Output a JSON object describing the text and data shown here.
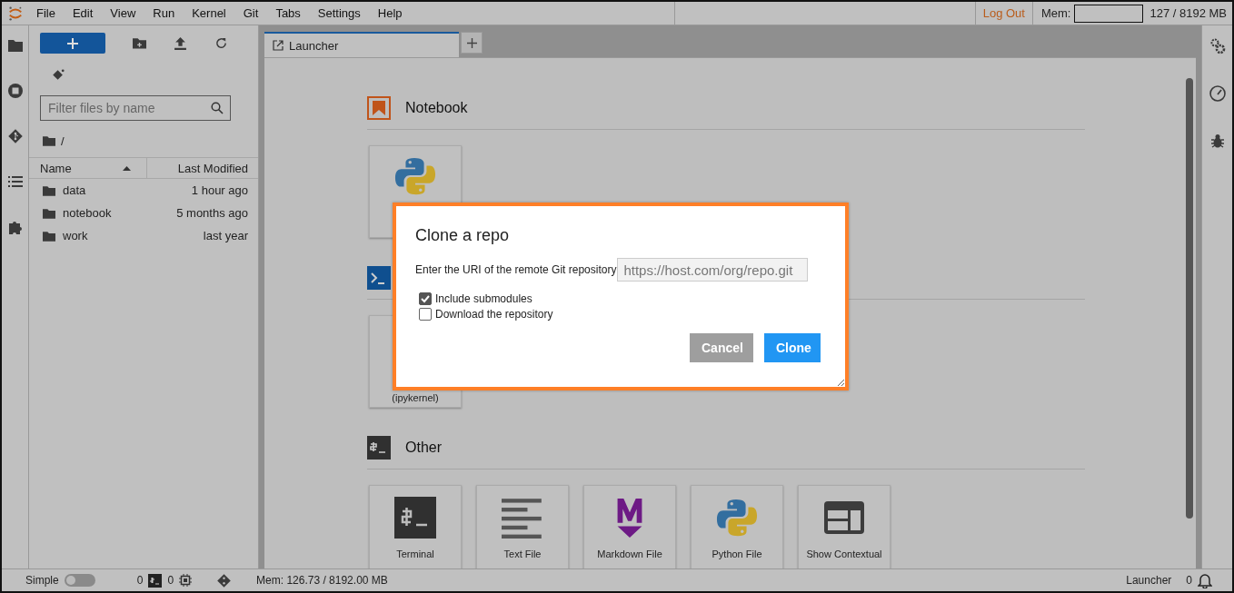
{
  "menu_bar": {
    "items": [
      "File",
      "Edit",
      "View",
      "Run",
      "Kernel",
      "Git",
      "Tabs",
      "Settings",
      "Help"
    ],
    "logout": "Log Out",
    "mem_label": "Mem:",
    "mem_value": "127 / 8192 MB"
  },
  "file_browser": {
    "filter_placeholder": "Filter files by name",
    "path": "/",
    "columns": [
      "Name",
      "Last Modified"
    ],
    "rows": [
      {
        "name": "data",
        "modified": "1 hour ago"
      },
      {
        "name": "notebook",
        "modified": "5 months ago"
      },
      {
        "name": "work",
        "modified": "last year"
      }
    ]
  },
  "tabs": [
    {
      "label": "Launcher",
      "selected": true
    }
  ],
  "launcher": {
    "sections": [
      {
        "kind": "notebook",
        "title": "Notebook",
        "tiles": [
          {
            "kind": "python"
          }
        ]
      },
      {
        "kind": "console",
        "tiles": [
          {
            "kind": "console",
            "label": "(ipykernel)"
          }
        ]
      },
      {
        "kind": "other",
        "title": "Other",
        "tiles": [
          {
            "kind": "terminal",
            "label": "Terminal"
          },
          {
            "kind": "text",
            "label": "Text File"
          },
          {
            "kind": "markdown",
            "label": "Markdown File"
          },
          {
            "kind": "python",
            "label": "Python File"
          },
          {
            "kind": "help",
            "label": "Show Contextual"
          }
        ]
      }
    ]
  },
  "dialog": {
    "title": "Clone a repo",
    "prompt": "Enter the URI of the remote Git repository",
    "url_placeholder": "https://host.com/org/repo.git",
    "options": [
      {
        "label": "Include submodules",
        "checked": true
      },
      {
        "label": "Download the repository",
        "checked": false
      }
    ],
    "buttons": [
      {
        "label": "Cancel",
        "kind": "secondary"
      },
      {
        "label": "Clone",
        "kind": "primary"
      }
    ]
  },
  "status_bar": {
    "mode_label": "Simple",
    "simple_on": false,
    "kernels": "0",
    "terminals": "0",
    "mem": "Mem: 126.73 / 8192.00 MB",
    "activity": "Launcher",
    "notifications": "0"
  }
}
